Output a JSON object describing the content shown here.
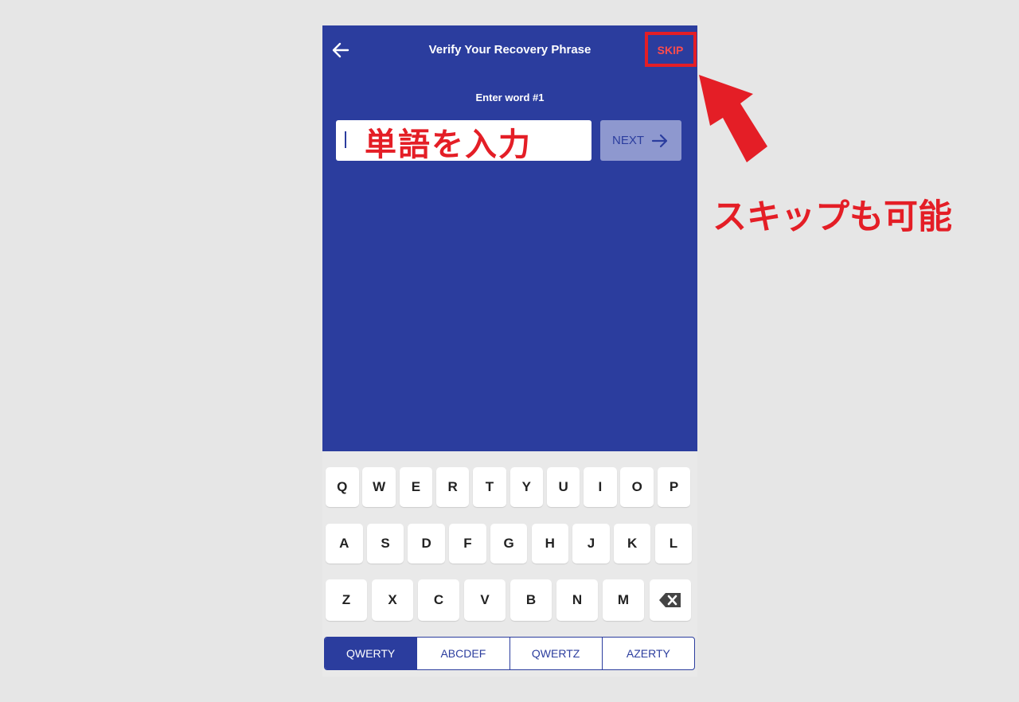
{
  "header": {
    "title": "Verify Your Recovery Phrase",
    "back_icon": "arrow-left-icon",
    "skip_label": "SKIP"
  },
  "prompt": {
    "subtitle": "Enter word #1",
    "input_value": "",
    "next_label": "NEXT",
    "next_icon": "arrow-right-icon"
  },
  "keyboard": {
    "row1": [
      "Q",
      "W",
      "E",
      "R",
      "T",
      "Y",
      "U",
      "I",
      "O",
      "P"
    ],
    "row2": [
      "A",
      "S",
      "D",
      "F",
      "G",
      "H",
      "J",
      "K",
      "L"
    ],
    "row3": [
      "Z",
      "X",
      "C",
      "V",
      "B",
      "N",
      "M"
    ],
    "backspace_icon": "backspace-icon",
    "layouts": [
      "QWERTY",
      "ABCDEF",
      "QWERTZ",
      "AZERTY"
    ],
    "active_layout": "QWERTY"
  },
  "annotations": {
    "input_hint": "単語を入力",
    "skip_hint": "スキップも可能"
  },
  "colors": {
    "primary": "#2b3d9e",
    "annotation": "#e41e26",
    "skip_text": "#ff4c4c"
  }
}
